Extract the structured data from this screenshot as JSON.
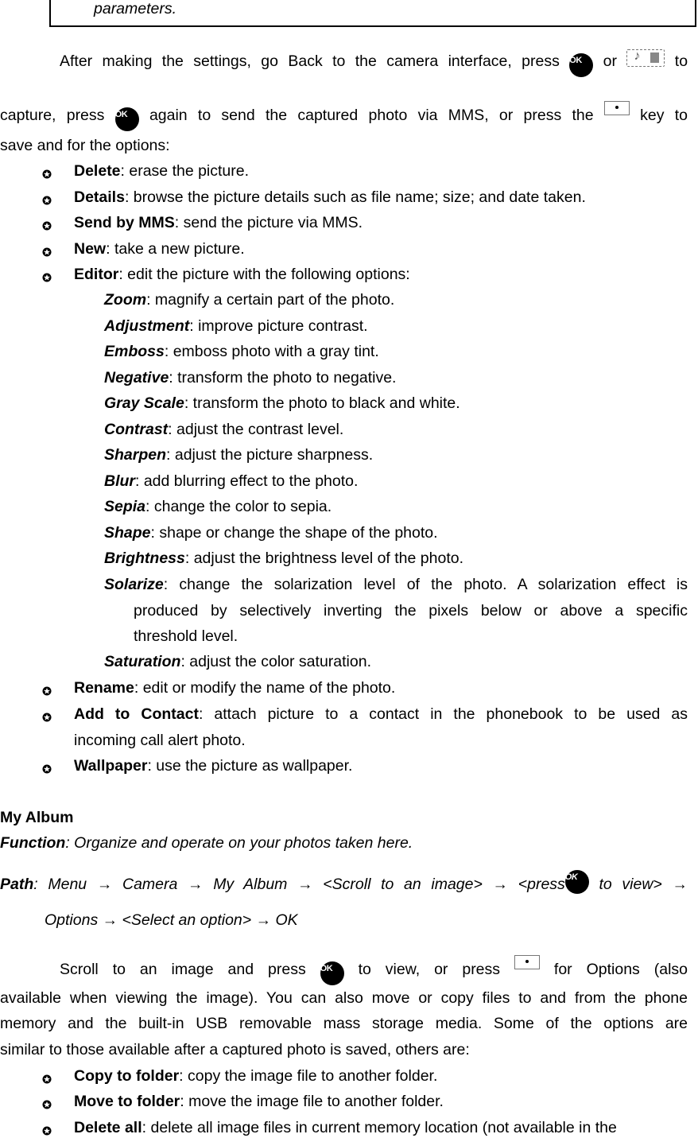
{
  "top_box": {
    "text": "parameters."
  },
  "para1": {
    "line1_a": "After making the settings, go Back to the camera interface, press",
    "line1_b": "or",
    "line1_c": "to",
    "line2_a": "capture, press",
    "line2_b": "again to send the captured photo via MMS, or press the",
    "line2_c": "key to",
    "line3": "save and for the options:"
  },
  "icons": {
    "ok_label": "OK"
  },
  "options": [
    {
      "term": "Delete",
      "desc": ": erase the picture."
    },
    {
      "term": "Details",
      "desc": ": browse the picture details such as file name; size; and date taken."
    },
    {
      "term": "Send by MMS",
      "desc": ": send the picture via MMS."
    },
    {
      "term": "New",
      "desc": ": take a new picture."
    },
    {
      "term": "Editor",
      "desc": ": edit the picture with the following options:"
    }
  ],
  "editor_options": [
    {
      "term": "Zoom",
      "desc": ": magnify a certain part of the photo."
    },
    {
      "term": "Adjustment",
      "desc": ": improve picture contrast."
    },
    {
      "term": "Emboss",
      "desc": ": emboss photo with a gray tint."
    },
    {
      "term": "Negative",
      "desc": ": transform the photo to negative."
    },
    {
      "term": "Gray Scale",
      "desc": ": transform the photo to black and white."
    },
    {
      "term": "Contrast",
      "desc": ": adjust the contrast level."
    },
    {
      "term": "Sharpen",
      "desc": ": adjust the picture sharpness."
    },
    {
      "term": "Blur",
      "desc": ": add blurring effect to the photo."
    },
    {
      "term": "Sepia",
      "desc": ": change the color to sepia."
    },
    {
      "term": "Shape",
      "desc": ": shape or change the shape of the photo."
    },
    {
      "term": "Brightness",
      "desc": ": adjust the brightness level of the photo."
    },
    {
      "term": "Solarize",
      "desc": ": change the solarization level of the photo. A solarization effect is",
      "cont1": "produced by selectively inverting the pixels below or above a specific",
      "cont2": "threshold level."
    },
    {
      "term": "Saturation",
      "desc": ": adjust the color saturation."
    }
  ],
  "options2": [
    {
      "term": "Rename",
      "desc": ": edit or modify the name of the photo."
    },
    {
      "term": "Add to Contact",
      "desc": ": attach picture to a contact in the phonebook to be used as",
      "cont1": "incoming call alert photo."
    },
    {
      "term": "Wallpaper",
      "desc": ": use the picture as wallpaper."
    }
  ],
  "album": {
    "heading": "My Album",
    "function_label": "Function",
    "function_text": ": Organize and operate on your photos taken here.",
    "path_label": "Path",
    "path_line1": [
      ": Menu ",
      " Camera ",
      " My Album ",
      " <Scroll to an image> ",
      " <press"
    ],
    "path_line1_end": " to view> ",
    "path_line2": [
      "Options ",
      " <Select an option> ",
      " OK"
    ],
    "arrow": "→",
    "para_l1_a": "Scroll to an image and press",
    "para_l1_b": "to view, or press",
    "para_l1_c": "for Options (also",
    "para_l2": "available when viewing the image). You can also move or copy files to and from the phone",
    "para_l3": "memory and the built-in USB removable mass storage media. Some of the options are",
    "para_l4": "similar to those available after a captured photo is saved, others are:"
  },
  "album_options": [
    {
      "term": "Copy to folder",
      "desc": ": copy the image file to another folder."
    },
    {
      "term": "Move to folder",
      "desc": ": move the image file to another folder."
    },
    {
      "term": "Delete all",
      "desc": ": delete all image files in current memory location (not available in the"
    }
  ]
}
